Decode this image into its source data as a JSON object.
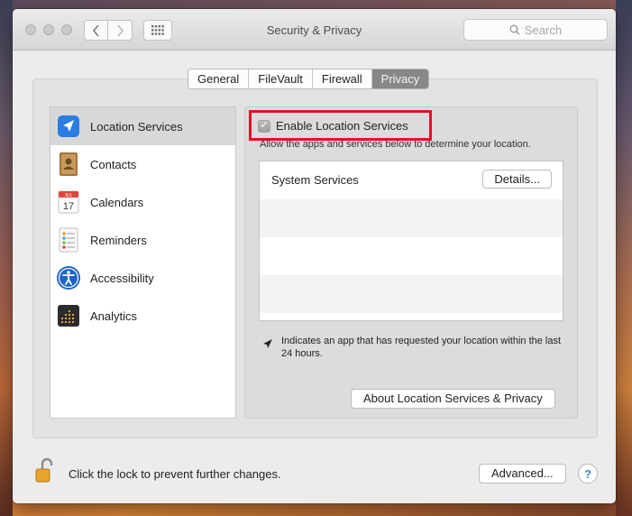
{
  "window": {
    "title": "Security & Privacy"
  },
  "search": {
    "placeholder": "Search"
  },
  "tabs": [
    {
      "label": "General"
    },
    {
      "label": "FileVault"
    },
    {
      "label": "Firewall"
    },
    {
      "label": "Privacy"
    }
  ],
  "sidebar": {
    "items": [
      {
        "label": "Location Services",
        "icon": "location-arrow-icon"
      },
      {
        "label": "Contacts",
        "icon": "contacts-book-icon"
      },
      {
        "label": "Calendars",
        "icon": "calendar-icon"
      },
      {
        "label": "Reminders",
        "icon": "reminders-list-icon"
      },
      {
        "label": "Accessibility",
        "icon": "accessibility-icon"
      },
      {
        "label": "Analytics",
        "icon": "analytics-grid-icon"
      }
    ]
  },
  "location": {
    "enable_label": "Enable Location Services",
    "subtitle": "Allow the apps and services below to determine your location.",
    "apps": [
      {
        "name": "System Services",
        "button": "Details..."
      }
    ],
    "note": "Indicates an app that has requested your location within the last 24 hours.",
    "about_button": "About Location Services & Privacy"
  },
  "footer": {
    "lock_text": "Click the lock to prevent further changes.",
    "advanced_button": "Advanced...",
    "help_label": "?"
  },
  "colors": {
    "highlight_box": "#e0112a",
    "selected_tab": "#888888"
  }
}
